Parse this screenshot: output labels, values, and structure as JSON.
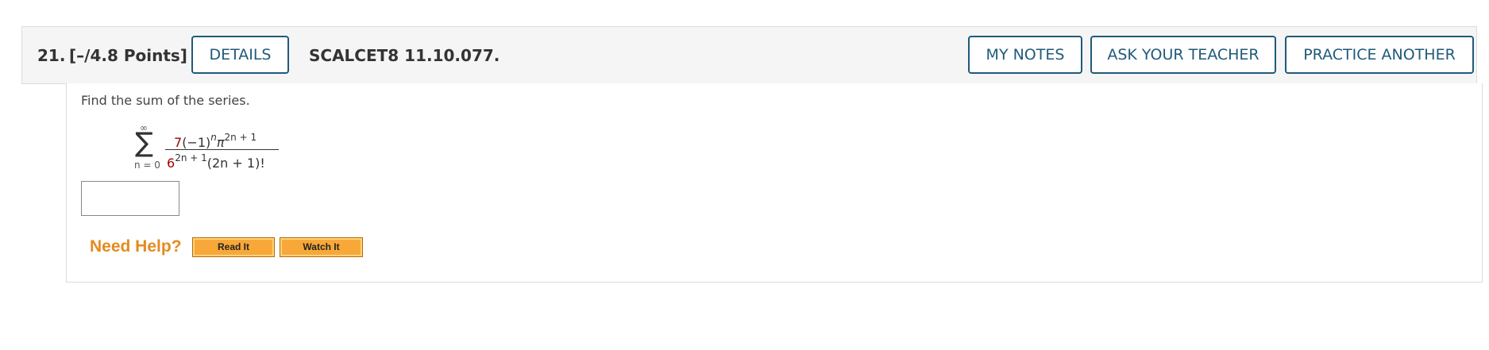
{
  "question": {
    "number": "21.",
    "points": "[–/4.8 Points]",
    "code": "SCALCET8 11.10.077."
  },
  "header_buttons": {
    "details": "DETAILS",
    "my_notes": "MY NOTES",
    "ask_teacher": "ASK YOUR TEACHER",
    "practice_another": "PRACTICE ANOTHER"
  },
  "body": {
    "prompt": "Find the sum of the series.",
    "series": {
      "upper_limit": "∞",
      "lower_limit": "n = 0",
      "sigma": "∑",
      "numerator": {
        "coef": "7",
        "paren": "(−1)",
        "exp_n": "n",
        "pi": "π",
        "exp_pi": "2n + 1"
      },
      "denominator": {
        "base": "6",
        "exp": "2n + 1",
        "factorial": "(2n + 1)!"
      }
    },
    "answer_value": ""
  },
  "help": {
    "label": "Need Help?",
    "read_it": "Read It",
    "watch_it": "Watch It"
  },
  "colors": {
    "accent": "#1f5a7a",
    "help_orange": "#e68a1f",
    "button_orange": "#f8a838",
    "math_red": "#a00000"
  }
}
